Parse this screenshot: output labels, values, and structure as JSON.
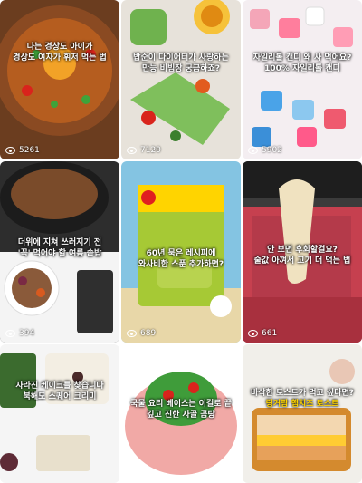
{
  "tiles": [
    {
      "caption_top": "나는 경상도 아이가",
      "caption_mid": "경상도 여자가 휘저 먹는 법",
      "views": "5261",
      "eye": "eye-icon"
    },
    {
      "caption_top": "밥순이 다이어터가 사랑하는",
      "caption_mid": "만능 비빔장 궁금하죠?",
      "views": "7120",
      "eye": "eye-icon"
    },
    {
      "caption_top": "자일리톨 캔디 왜 사 먹어요?",
      "caption_mid": "100% 자일리톨 캔디",
      "views": "5902",
      "eye": "eye-icon"
    },
    {
      "caption_top": "더위에 지쳐 쓰러지기 전",
      "caption_mid": "'꼭' 먹어야 할 여름 솥밥",
      "views": "394",
      "eye": "eye-icon"
    },
    {
      "caption_top": "60년 묵은 레시피에",
      "caption_mid": "와사비한 스푼 추가하면?",
      "views": "689",
      "eye": "eye-icon"
    },
    {
      "caption_top": "안 보면 후회할걸요?",
      "caption_mid": "술값 아껴서 고기 더 먹는 법",
      "views": "661",
      "eye": "eye-icon"
    },
    {
      "caption_top": "사라진 케이크를 찾습니다",
      "caption_mid": "북해도 스퀘어 크리미",
      "views": "",
      "eye": "eye-icon"
    },
    {
      "caption_top": "국물 요리 베이스는 이걸로 끝",
      "caption_mid": "깊고 진한 사골 곰탕",
      "views": "",
      "eye": "eye-icon"
    },
    {
      "caption_top": "바삭한 토스트가 먹고 싶다면?",
      "caption_mid": "링거팜 햄치즈 토스트",
      "views": "",
      "eye": "eye-icon"
    }
  ],
  "colors": {
    "accent": "#ffd400"
  }
}
